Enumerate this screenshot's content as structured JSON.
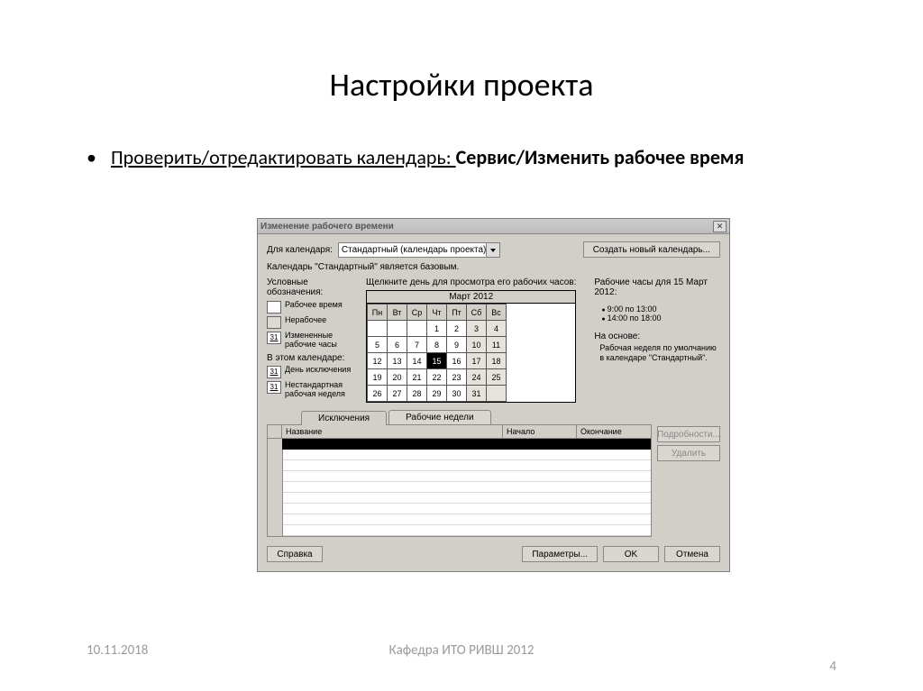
{
  "slide": {
    "title": "Настройки проекта",
    "bullet_prefix": "Проверить/отредактировать календарь: ",
    "bullet_bold": "Сервис/Изменить рабочее время",
    "footer_date": "10.11.2018",
    "footer_center": "Кафедра ИТО РИВШ 2012",
    "footer_page": "4"
  },
  "dialog": {
    "title": "Изменение рабочего времени",
    "for_calendar_label": "Для календаря:",
    "calendar_selected": "Стандартный (календарь проекта)",
    "new_calendar_btn": "Создать новый календарь...",
    "base_note": "Календарь \"Стандартный\" является базовым.",
    "legend": {
      "title": "Условные обозначения:",
      "work": "Рабочее время",
      "nonwork": "Нерабочее",
      "changed_hours": "Измененные рабочие часы",
      "sub_title": "В этом календаре:",
      "day_exception": "День исключения",
      "nonstd_week": "Нестандартная рабочая неделя",
      "icon31": "31"
    },
    "calendar": {
      "click_hint": "Щелкните день для просмотра его рабочих часов:",
      "month": "Март 2012",
      "weekdays": [
        "Пн",
        "Вт",
        "Ср",
        "Чт",
        "Пт",
        "Сб",
        "Вс"
      ],
      "rows": [
        [
          "",
          "",
          "",
          "1",
          "2",
          "3",
          "4"
        ],
        [
          "5",
          "6",
          "7",
          "8",
          "9",
          "10",
          "11"
        ],
        [
          "12",
          "13",
          "14",
          "15",
          "16",
          "17",
          "18"
        ],
        [
          "19",
          "20",
          "21",
          "22",
          "23",
          "24",
          "25"
        ],
        [
          "26",
          "27",
          "28",
          "29",
          "30",
          "31",
          ""
        ]
      ],
      "selected_day": "15"
    },
    "hours": {
      "title": "Рабочие часы для 15 Март 2012:",
      "slot1": "9:00 по 13:00",
      "slot2": "14:00 по 18:00",
      "based_label": "На основе:",
      "based_text": "Рабочая неделя по умолчанию в календаре \"Стандартный\"."
    },
    "tabs": {
      "exceptions": "Исключения",
      "workweeks": "Рабочие недели"
    },
    "grid": {
      "col_name": "Название",
      "col_start": "Начало",
      "col_end": "Окончание"
    },
    "side": {
      "details": "Подробности...",
      "delete": "Удалить"
    },
    "bottom": {
      "help": "Справка",
      "params": "Параметры...",
      "ok": "OK",
      "cancel": "Отмена"
    }
  }
}
